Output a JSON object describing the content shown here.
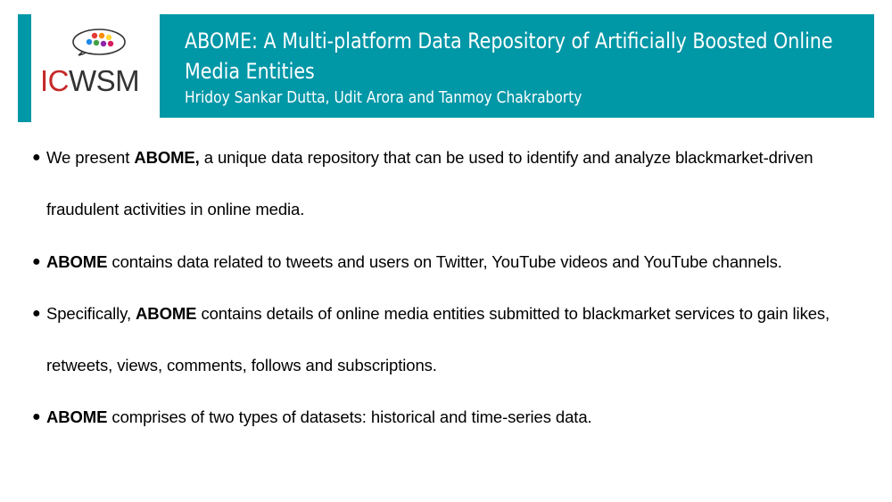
{
  "logo": {
    "text_ic": "IC",
    "text_wsm": "WSM",
    "dot_colors": [
      "#e53935",
      "#fb8c00",
      "#fdd835",
      "#43a047",
      "#1e88e5",
      "#8e24aa",
      "#d81b60"
    ]
  },
  "header": {
    "title": "ABOME: A Multi-platform Data Repository of Artificially Boosted Online Media Entities",
    "authors": "Hridoy Sankar Dutta, Udit Arora and Tanmoy Chakraborty"
  },
  "bullets": [
    {
      "pre": "We present ",
      "bold": "ABOME,",
      "post": " a unique data repository that can be used to identify and analyze blackmarket-driven fraudulent activities in online media."
    },
    {
      "pre": "",
      "bold": "ABOME",
      "post": " contains data related to tweets and users on Twitter, YouTube videos and YouTube channels."
    },
    {
      "pre": "Specifically, ",
      "bold": "ABOME",
      "post": " contains details of online media entities submitted to blackmarket services to gain likes, retweets, views, comments, follows and subscriptions."
    },
    {
      "pre": "",
      "bold": "ABOME",
      "post": " comprises of two types of datasets: historical and time-series data."
    }
  ],
  "colors": {
    "accent": "#0097a7",
    "logo_red": "#c62828",
    "logo_gray": "#333333"
  }
}
